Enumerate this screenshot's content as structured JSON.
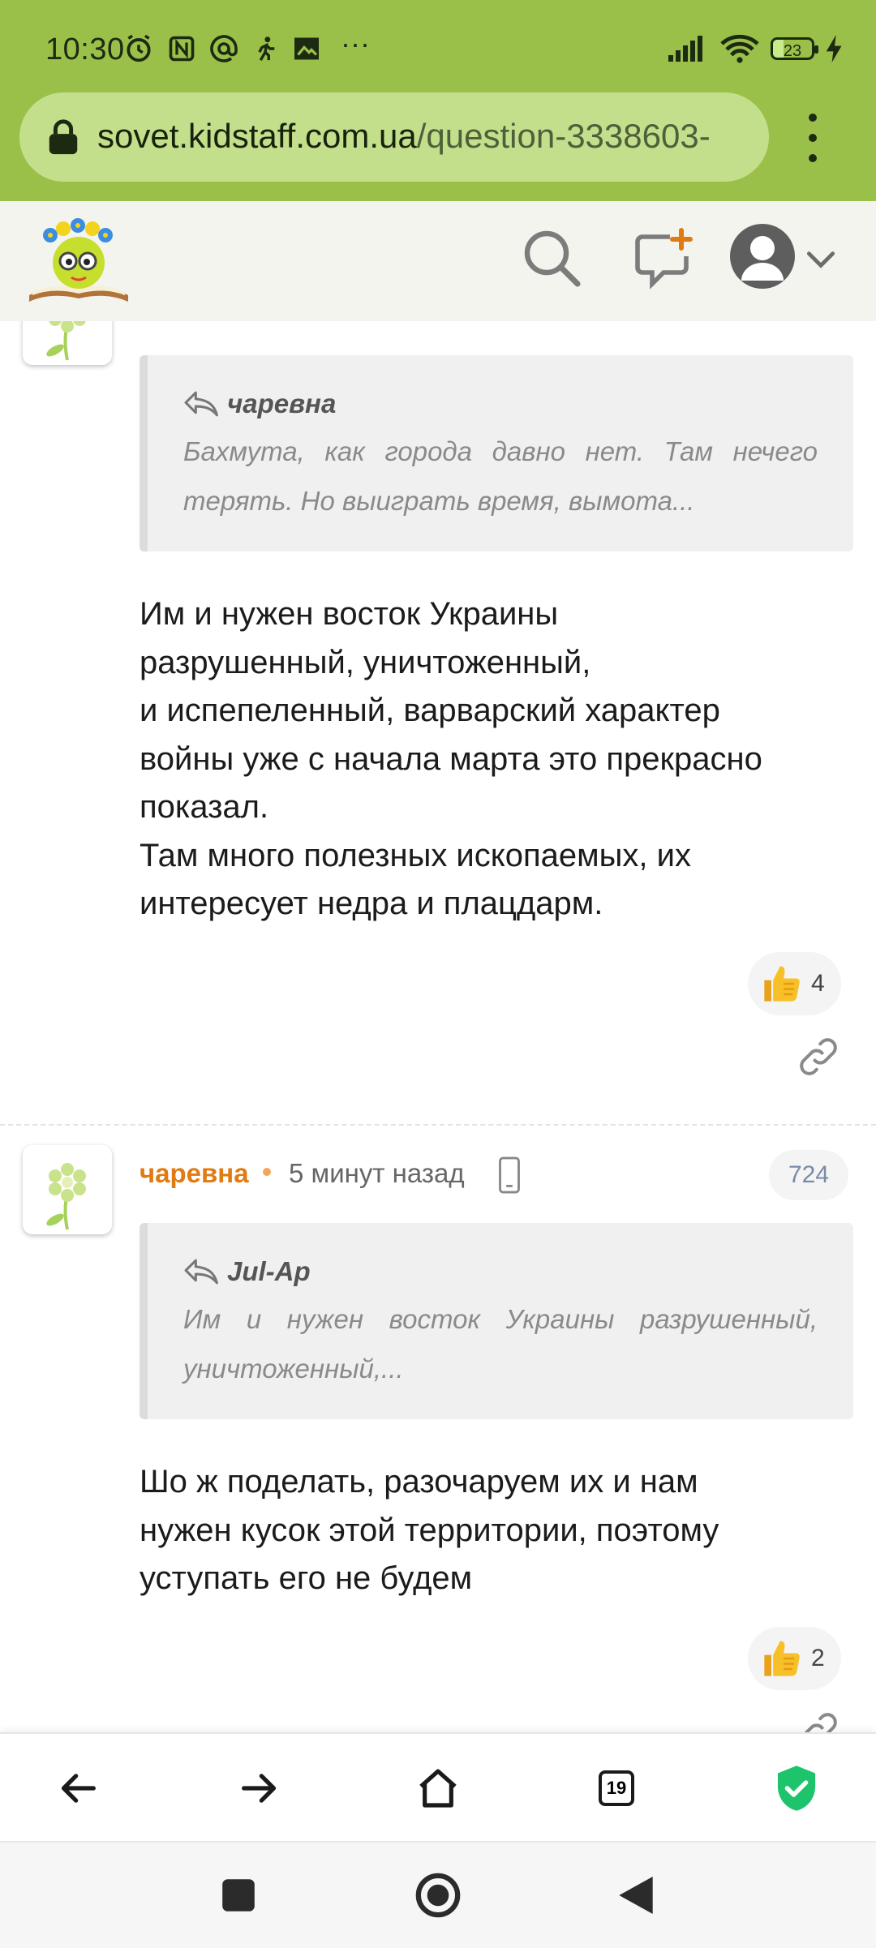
{
  "status_bar": {
    "time": "10:30",
    "battery": "23",
    "battery_level_percent": 23
  },
  "browser": {
    "url_domain": "sovet.kidstaff.com.ua",
    "url_path": "/question-3338603-",
    "tab_count": "19"
  },
  "icons": {
    "lock": "lock-icon",
    "search": "search-icon",
    "new_question": "new-question-icon",
    "user": "user-icon",
    "chevron": "chevron-down-icon",
    "reply": "reply-icon",
    "thumbs_up": "thumbs-up-icon",
    "link": "link-icon",
    "phone": "phone-icon",
    "back": "back-arrow-icon",
    "forward": "forward-arrow-icon",
    "home": "home-icon",
    "shield": "shield-check-icon"
  },
  "colors": {
    "accent_green": "#9bc04a",
    "author_orange": "#e07b12",
    "shield_green": "#1ec46b"
  },
  "posts": [
    {
      "quote_author": "чаревна",
      "quote_text": "Бахмута, как города давно нет. Там нечего терять. Но выиграть время, вымота...",
      "body": "Им и нужен восток Украины\nразрушенный, уничтоженный,\nи испепеленный, варварский характер\nвойны уже с начала марта это прекрасно\nпоказал.\nТам много полезных ископаемых, их\nинтересует недра и плацдарм.",
      "likes": "4"
    },
    {
      "author": "чаревна",
      "time": "5 минут назад",
      "number": "724",
      "quote_author": "Jul-Ap",
      "quote_text": "Им и нужен восток Украины разрушенный, уничтоженный,...",
      "body": "Шо ж поделать, разочаруем их и нам\nнужен кусок этой территории, поэтому\nуступать его не будем",
      "likes": "2"
    }
  ]
}
